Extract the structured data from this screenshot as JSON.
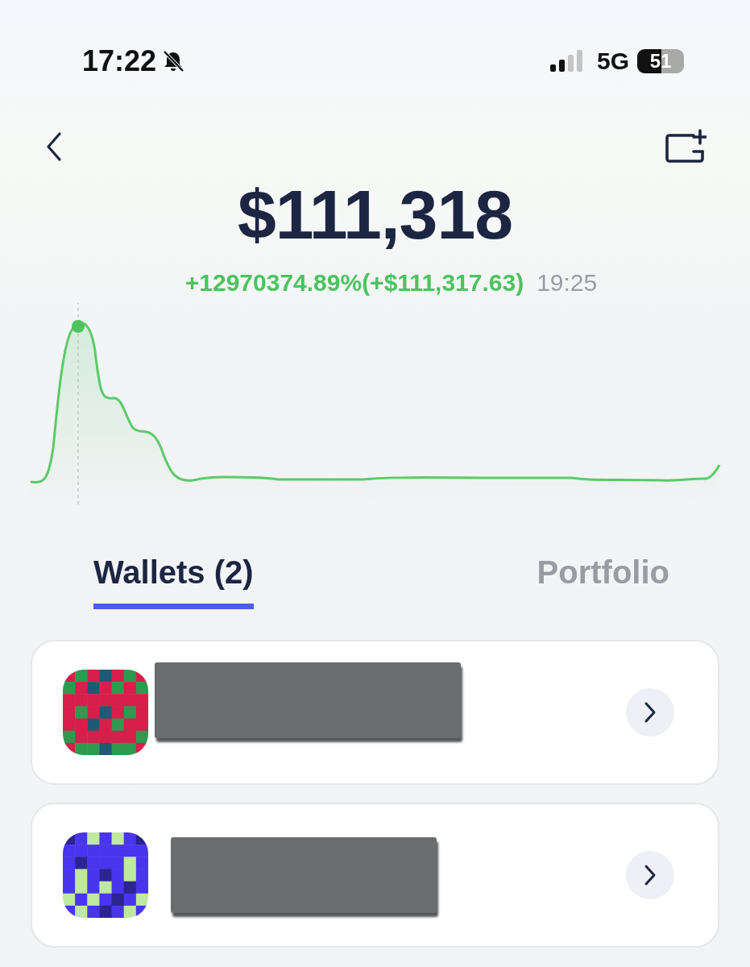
{
  "status_bar": {
    "time": "17:22",
    "network": "5G",
    "battery": "51"
  },
  "balance": {
    "amount": "$111,318",
    "change": "+12970374.89%(+$111,317.63)",
    "time": "19:25"
  },
  "tabs": [
    {
      "label": "Wallets (2)",
      "selected": true
    },
    {
      "label": "Portfolio",
      "selected": false
    }
  ],
  "wallets": [
    {
      "color": "#d81e4a",
      "redacted": true
    },
    {
      "color": "#4a35ee",
      "redacted": true
    }
  ]
}
